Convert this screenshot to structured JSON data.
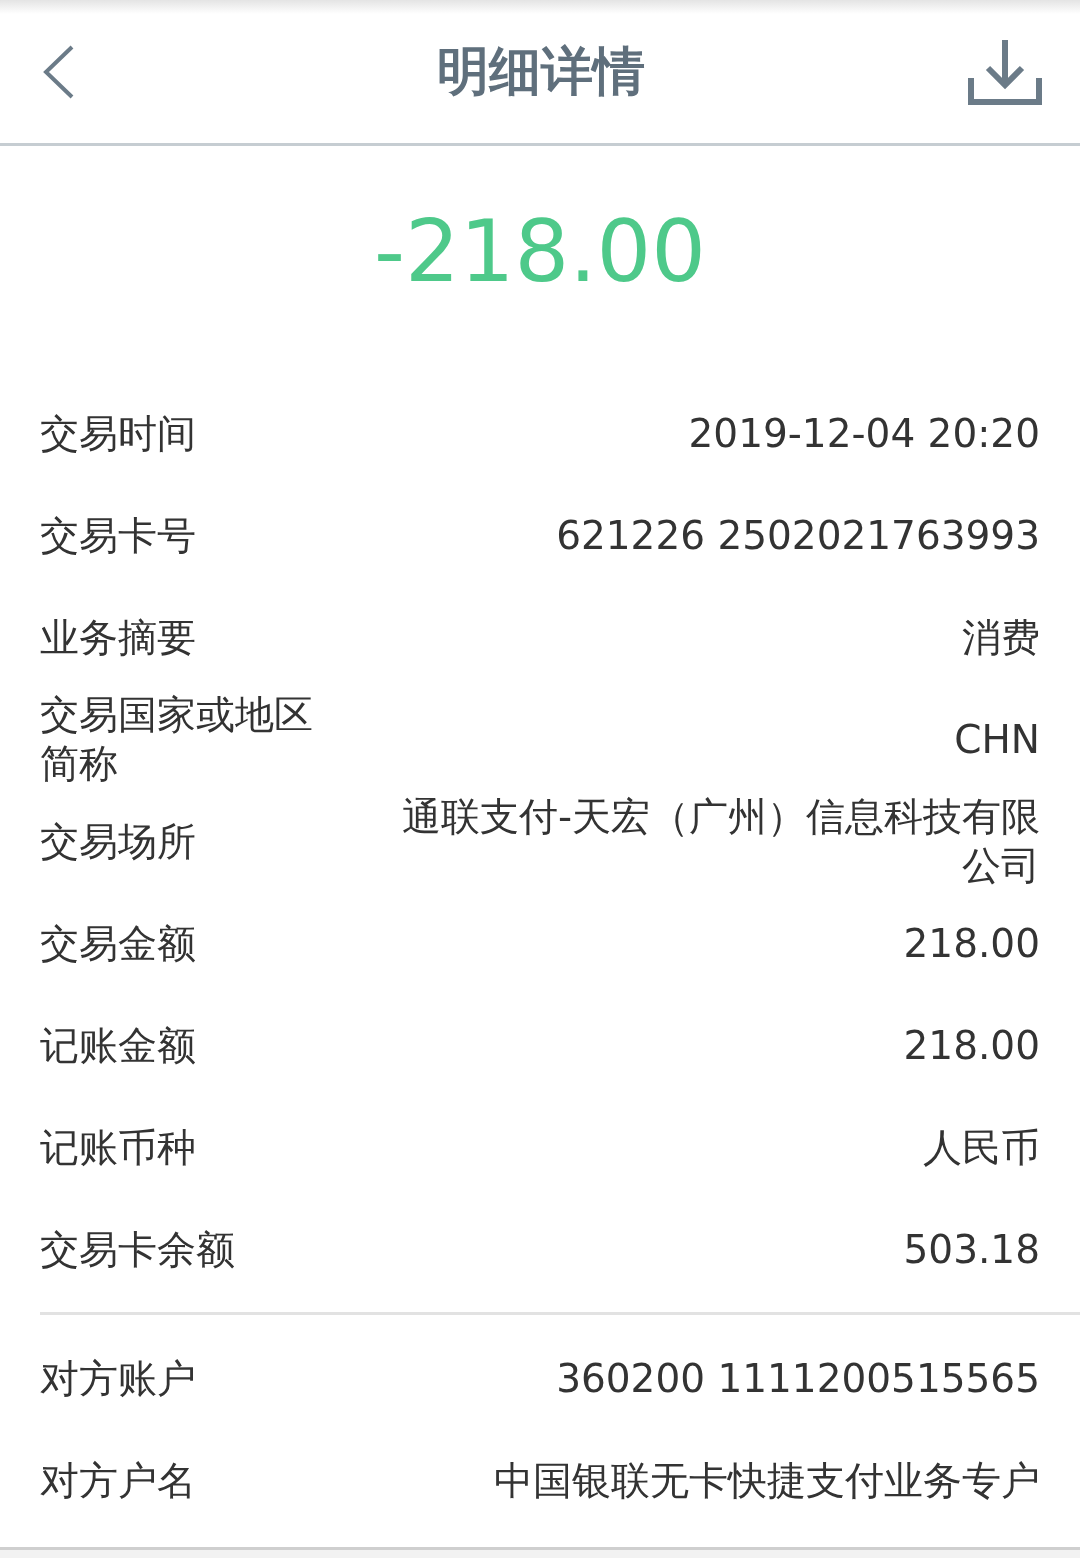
{
  "header": {
    "title": "明细详情"
  },
  "amount": "-218.00",
  "groups": [
    {
      "rows": [
        {
          "label": "交易时间",
          "value": "2019-12-04 20:20"
        },
        {
          "label": "交易卡号",
          "value": "621226 2502021763993"
        },
        {
          "label": "业务摘要",
          "value": "消费"
        },
        {
          "label": "交易国家或地区简称",
          "value": "CHN"
        },
        {
          "label": "交易场所",
          "value": "通联支付-天宏（广州）信息科技有限公司"
        },
        {
          "label": "交易金额",
          "value": "218.00"
        },
        {
          "label": "记账金额",
          "value": "218.00"
        },
        {
          "label": "记账币种",
          "value": "人民币"
        },
        {
          "label": "交易卡余额",
          "value": "503.18"
        }
      ]
    },
    {
      "rows": [
        {
          "label": "对方账户",
          "value": "360200 1111200515565"
        },
        {
          "label": "对方户名",
          "value": "中国银联无卡快捷支付业务专户"
        }
      ]
    }
  ]
}
